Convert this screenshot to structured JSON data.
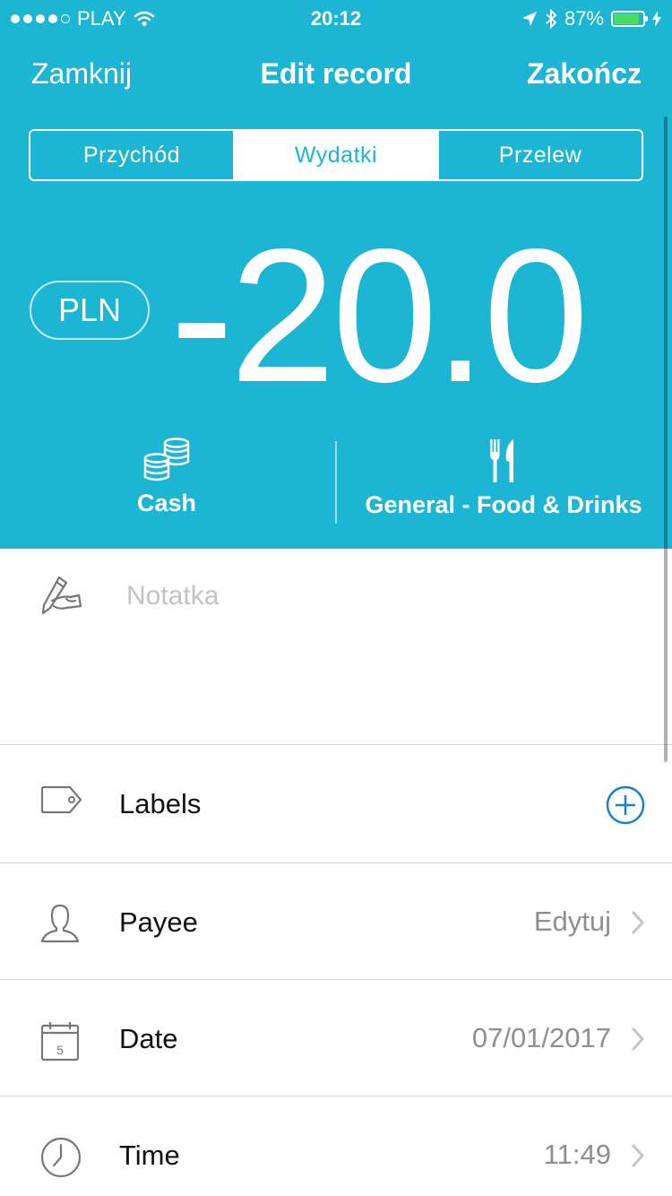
{
  "status_bar": {
    "carrier": "PLAY",
    "time": "20:12",
    "battery": "87%",
    "battery_level": 0.87
  },
  "nav": {
    "close_label": "Zamknij",
    "title": "Edit record",
    "finish_label": "Zakończ"
  },
  "segments": [
    {
      "label": "Przychód",
      "active": false
    },
    {
      "label": "Wydatki",
      "active": true
    },
    {
      "label": "Przelew",
      "active": false
    }
  ],
  "currency": "PLN",
  "amount": "-20.0",
  "account": {
    "label": "Cash",
    "icon": "coins-icon"
  },
  "category": {
    "label": "General - Food & Drinks",
    "icon": "fork-knife-icon"
  },
  "note": {
    "placeholder": "Notatka",
    "icon": "pencil-hand-icon"
  },
  "rows": {
    "labels": {
      "label": "Labels",
      "icon": "tag-icon",
      "action_icon": "add-circle-icon"
    },
    "payee": {
      "label": "Payee",
      "value": "Edytuj",
      "icon": "person-icon"
    },
    "date": {
      "label": "Date",
      "value": "07/01/2017",
      "icon": "calendar-icon",
      "icon_text": "5"
    },
    "time": {
      "label": "Time",
      "value": "11:49",
      "icon": "clock-icon"
    }
  },
  "colors": {
    "accent": "#1cb5d4",
    "link": "#1a7fd6",
    "battery": "#4cd964"
  }
}
